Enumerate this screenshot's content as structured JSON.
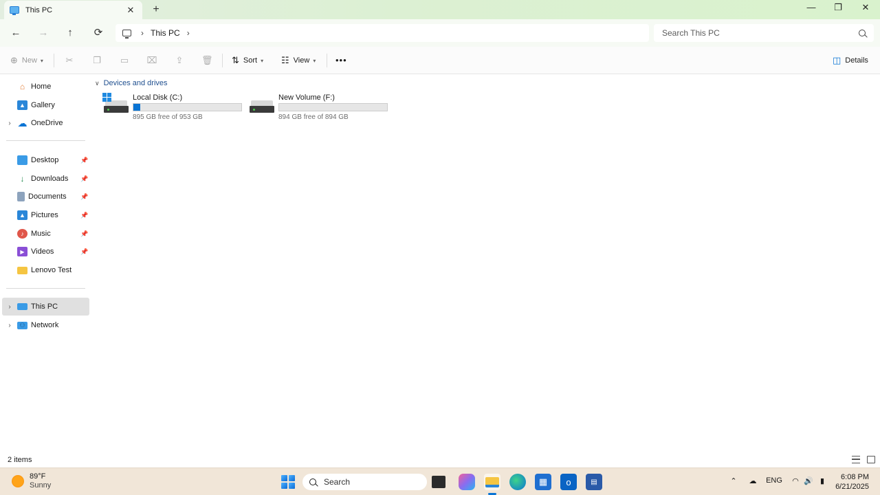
{
  "window": {
    "tab_title": "This PC",
    "tab_close": "✕",
    "new_tab": "+",
    "minimize": "—",
    "restore": "❐",
    "close": "✕"
  },
  "nav": {
    "back": "←",
    "forward": "→",
    "up": "↑",
    "refresh": "⟳"
  },
  "address": {
    "crumbs": [
      "This PC"
    ],
    "separator": "›"
  },
  "search": {
    "placeholder": "Search This PC"
  },
  "toolbar": {
    "new_label": "New",
    "sort_label": "Sort",
    "view_label": "View",
    "more_label": "•••",
    "details_label": "Details"
  },
  "sidebar": {
    "items": [
      {
        "label": "Home",
        "icon": "home-icon"
      },
      {
        "label": "Gallery",
        "icon": "gallery-icon"
      },
      {
        "label": "OneDrive",
        "icon": "onedrive-icon"
      },
      {
        "label": "Desktop",
        "icon": "desktop-folder-icon",
        "pinned": true
      },
      {
        "label": "Downloads",
        "icon": "download-icon",
        "pinned": true
      },
      {
        "label": "Documents",
        "icon": "documents-icon",
        "pinned": true
      },
      {
        "label": "Pictures",
        "icon": "pictures-icon",
        "pinned": true
      },
      {
        "label": "Music",
        "icon": "music-icon",
        "pinned": true
      },
      {
        "label": "Videos",
        "icon": "videos-icon",
        "pinned": true
      },
      {
        "label": "Lenovo Test",
        "icon": "folder-icon"
      },
      {
        "label": "This PC",
        "icon": "this-pc-icon",
        "selected": true
      },
      {
        "label": "Network",
        "icon": "network-icon"
      }
    ]
  },
  "main": {
    "group_label": "Devices and drives",
    "drives": [
      {
        "name": "Local Disk (C:)",
        "free_text": "895 GB free of 953 GB",
        "used_fraction": 0.061
      },
      {
        "name": "New Volume (F:)",
        "free_text": "894 GB free of 894 GB",
        "used_fraction": 0.0
      }
    ]
  },
  "statusbar": {
    "item_count": "2 items"
  },
  "taskbar": {
    "weather_temp": "89°F",
    "weather_desc": "Sunny",
    "search_label": "Search",
    "lang": "ENG",
    "time": "6:08 PM",
    "date": "6/21/2025"
  },
  "colors": {
    "accent": "#0a74d4",
    "titlebar": "#dcf0d3",
    "selected_item": "#e0e0e0",
    "taskbar": "#f1e6d8"
  }
}
